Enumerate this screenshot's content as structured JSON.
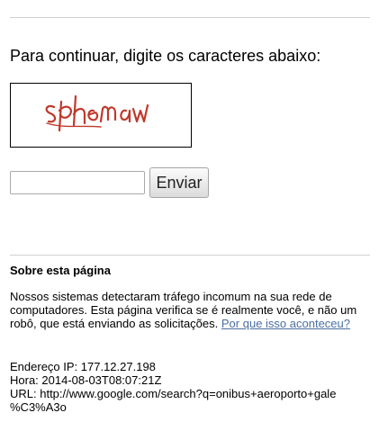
{
  "prompt": "Para continuar, digite os caracteres abaixo:",
  "captcha": {
    "text": "sphemaw",
    "text_color": "#c0392b"
  },
  "form": {
    "input_value": "",
    "input_placeholder": "",
    "submit_label": "Enviar"
  },
  "about": {
    "title": "Sobre esta página",
    "lines": [
      "Nossos sistemas detectaram tráfego incomum na sua rede de",
      "computadores. Esta página verifica se é realmente você, e não um",
      "robô, que está enviando as solicitações."
    ],
    "link_text": "Por que isso aconteceu?"
  },
  "info": {
    "ip_line": "Endereço IP: 177.12.27.198",
    "time_line": "Hora: 2014-08-03T08:07:21Z",
    "url_line_1": "URL: http://www.google.com/search?q=onibus+aeroporto+gale",
    "url_line_2": "%C3%A3o"
  }
}
